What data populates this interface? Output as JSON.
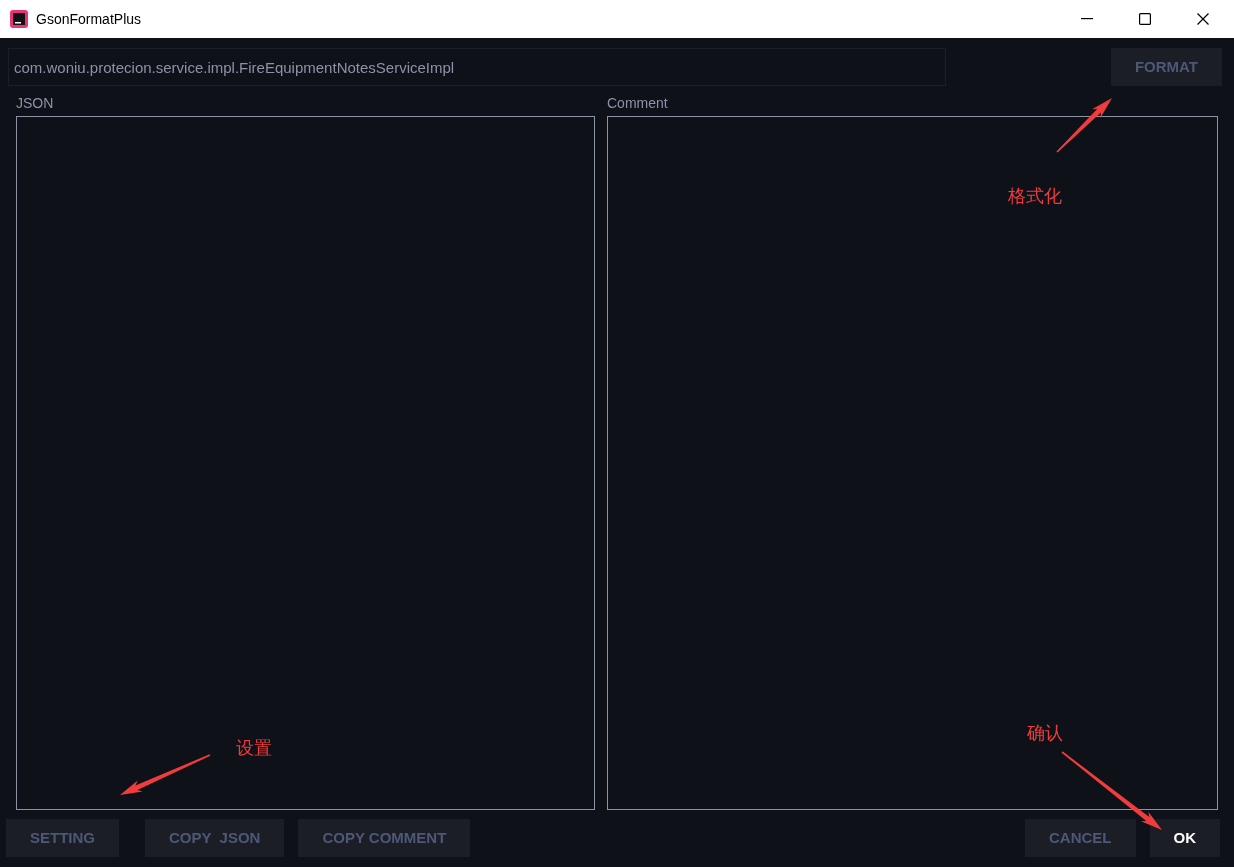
{
  "window": {
    "title": "GsonFormatPlus"
  },
  "class_field": {
    "value": "com.woniu.protecion.service.impl.FireEquipmentNotesServiceImpl"
  },
  "format_button": {
    "label": "FORMAT"
  },
  "panels": [
    {
      "label": "JSON"
    },
    {
      "label": "Comment"
    }
  ],
  "left_buttons": [
    {
      "label": "SETTING",
      "default": false
    },
    {
      "label": "COPY  JSON",
      "default": false
    },
    {
      "label": "COPY COMMENT",
      "default": false
    }
  ],
  "right_buttons": [
    {
      "label": "CANCEL",
      "default": false
    },
    {
      "label": "OK",
      "default": true
    }
  ],
  "annotations": [
    {
      "text": "格式化"
    },
    {
      "text": "设置"
    },
    {
      "text": "确认"
    }
  ]
}
